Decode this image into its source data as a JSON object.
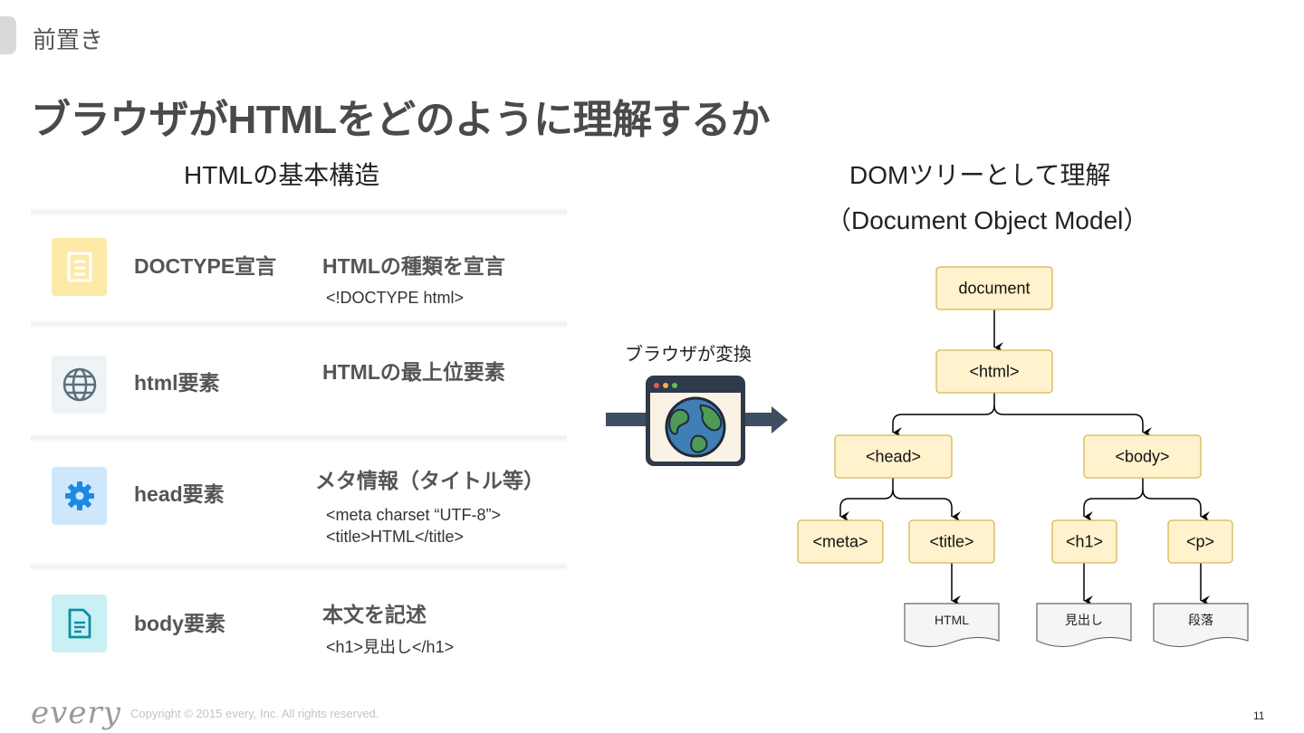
{
  "header": {
    "section": "前置き",
    "title": "ブラウザがHTMLをどのように理解するか"
  },
  "left": {
    "heading": "HTMLの基本構造",
    "rows": [
      {
        "name": "DOCTYPE宣言",
        "desc": "HTMLの種類を宣言",
        "code": [
          "<!DOCTYPE html>"
        ],
        "icon": "document-list-icon",
        "icon_bg": "#fdeaa8",
        "icon_color": "#ffffff"
      },
      {
        "name": "html要素",
        "desc": "HTMLの最上位要素",
        "code": [],
        "icon": "globe-icon",
        "icon_bg": "#eef4f6",
        "icon_color": "#5b6e7c"
      },
      {
        "name": "head要素",
        "desc": "メタ情報（タイトル等）",
        "code": [
          "<meta charset “UTF-8”>",
          "<title>HTML</title>"
        ],
        "icon": "gear-icon",
        "icon_bg": "#cfe7fb",
        "icon_color": "#1e88e5"
      },
      {
        "name": "body要素",
        "desc": "本文を記述",
        "code": [
          "<h1>見出し</h1>"
        ],
        "icon": "document-icon",
        "icon_bg": "#c9f0f5",
        "icon_color": "#0c8ea3"
      }
    ]
  },
  "middle": {
    "label": "ブラウザが変換",
    "icon": "browser-globe-icon"
  },
  "right": {
    "heading_line1": "DOMツリーとして理解",
    "heading_line2": "（Document Object Model）",
    "nodes": {
      "document": "document",
      "html": "<html>",
      "head": "<head>",
      "body": "<body>",
      "meta": "<meta>",
      "title": "<title>",
      "h1": "<h1>",
      "p": "<p>"
    },
    "leaves": {
      "title_text": "HTML",
      "h1_text": "見出し",
      "p_text": "段落"
    },
    "node_fill": "#fff2cc",
    "node_stroke": "#d6b656"
  },
  "footer": {
    "logo": "every",
    "copyright": "Copyright © 2015 every, Inc. All rights reserved.",
    "page": "11"
  }
}
